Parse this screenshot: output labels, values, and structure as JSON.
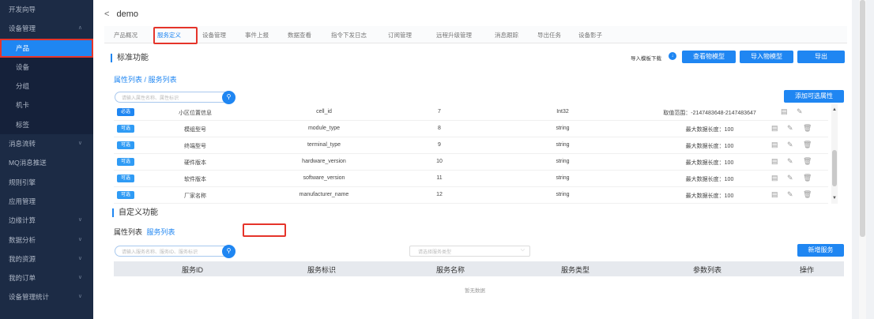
{
  "sidebar": {
    "items": [
      {
        "label": "开发向导",
        "chevron": false,
        "sub": false,
        "active": false
      },
      {
        "label": "设备管理",
        "chevron": true,
        "chev_dir": "up",
        "sub": false,
        "active": false
      },
      {
        "label": "产品",
        "chevron": false,
        "sub": true,
        "active": true
      },
      {
        "label": "设备",
        "chevron": false,
        "sub": true,
        "active": false
      },
      {
        "label": "分组",
        "chevron": false,
        "sub": true,
        "active": false
      },
      {
        "label": "机卡",
        "chevron": false,
        "sub": true,
        "active": false
      },
      {
        "label": "标签",
        "chevron": false,
        "sub": true,
        "active": false
      },
      {
        "label": "消息流转",
        "chevron": true,
        "chev_dir": "down",
        "sub": false,
        "active": false
      },
      {
        "label": "MQ消息推送",
        "chevron": false,
        "sub": false,
        "active": false
      },
      {
        "label": "规则引擎",
        "chevron": false,
        "sub": false,
        "active": false
      },
      {
        "label": "应用管理",
        "chevron": false,
        "sub": false,
        "active": false
      },
      {
        "label": "边缘计算",
        "chevron": true,
        "chev_dir": "down",
        "sub": false,
        "active": false
      },
      {
        "label": "数据分析",
        "chevron": true,
        "chev_dir": "down",
        "sub": false,
        "active": false
      },
      {
        "label": "我的资源",
        "chevron": true,
        "chev_dir": "down",
        "sub": false,
        "active": false
      },
      {
        "label": "我的订单",
        "chevron": true,
        "chev_dir": "down",
        "sub": false,
        "active": false
      },
      {
        "label": "设备管理统计",
        "chevron": true,
        "chev_dir": "down",
        "sub": false,
        "active": false
      }
    ]
  },
  "header": {
    "back_label": "demo"
  },
  "tabs": [
    {
      "label": "产品概况",
      "active": false
    },
    {
      "label": "服务定义",
      "active": true
    },
    {
      "label": "设备管理",
      "active": false
    },
    {
      "label": "事件上报",
      "active": false
    },
    {
      "label": "数据查看",
      "active": false
    },
    {
      "label": "指令下发日志",
      "active": false
    },
    {
      "label": "订阅管理",
      "active": false
    },
    {
      "label": "远程升级管理",
      "active": false
    },
    {
      "label": "消息跟踪",
      "active": false
    },
    {
      "label": "导出任务",
      "active": false
    },
    {
      "label": "设备影子",
      "active": false
    }
  ],
  "standard": {
    "title": "标准功能",
    "import_template_label": "导入模板下载",
    "view_model_button": "查看物模型",
    "import_model_button": "导入物模型",
    "export_button": "导出",
    "links": {
      "attr": "属性列表",
      "sep": "/",
      "svc": "服务列表"
    },
    "search_placeholder": "请输入属性名称、属性标识",
    "add_optional_button": "添加可选属性",
    "rows": [
      {
        "tag": "必选",
        "required": true,
        "name": "小区位置信息",
        "id": "cell_id",
        "num": "7",
        "type": "Int32",
        "desc": "取值范围：-2147483648-2147483647",
        "deletable": false
      },
      {
        "tag": "可选",
        "required": false,
        "name": "模组型号",
        "id": "module_type",
        "num": "8",
        "type": "string",
        "desc": "最大数据长度：100",
        "deletable": true
      },
      {
        "tag": "可选",
        "required": false,
        "name": "终端型号",
        "id": "terminal_type",
        "num": "9",
        "type": "string",
        "desc": "最大数据长度：100",
        "deletable": true
      },
      {
        "tag": "可选",
        "required": false,
        "name": "硬件版本",
        "id": "hardware_version",
        "num": "10",
        "type": "string",
        "desc": "最大数据长度：100",
        "deletable": true
      },
      {
        "tag": "可选",
        "required": false,
        "name": "软件版本",
        "id": "software_version",
        "num": "11",
        "type": "string",
        "desc": "最大数据长度：100",
        "deletable": true
      },
      {
        "tag": "可选",
        "required": false,
        "name": "厂家名称",
        "id": "manufacturer_name",
        "num": "12",
        "type": "string",
        "desc": "最大数据长度：100",
        "deletable": true
      }
    ]
  },
  "custom": {
    "title": "自定义功能",
    "links": {
      "attr": "属性列表",
      "svc": "服务列表"
    },
    "search_placeholder": "请输入服务名称、服务ID、服务标识",
    "type_select_placeholder": "请选择服务类型",
    "add_service_button": "新增服务",
    "columns": [
      "服务ID",
      "服务标识",
      "服务名称",
      "服务类型",
      "参数列表",
      "操作"
    ],
    "empty_text": "暂无数据"
  },
  "icons": {
    "back": "chevron-left-icon",
    "search": "search-icon",
    "view": "view-icon",
    "edit": "pencil-icon",
    "delete": "trash-icon",
    "download": "download-icon"
  },
  "colors": {
    "sidebar_bg": "#1c2b45",
    "accent": "#1f86f2",
    "highlight_box": "#e5342a"
  }
}
